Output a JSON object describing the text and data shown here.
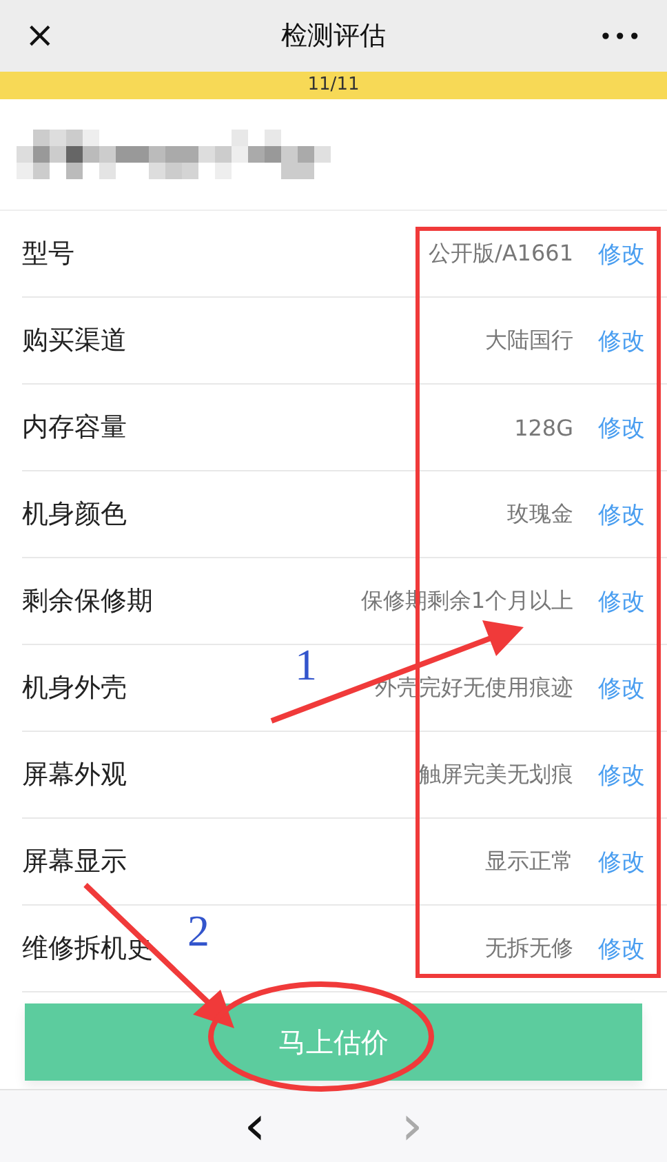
{
  "nav_bar": {
    "close": "×",
    "title": "检测评估",
    "more": "•••"
  },
  "progress": {
    "label": "11/11",
    "level": 1
  },
  "items": [
    {
      "label": "型号",
      "value": "公开版/A1661",
      "action": "修改"
    },
    {
      "label": "购买渠道",
      "value": "大陆国行",
      "action": "修改"
    },
    {
      "label": "内存容量",
      "value": "128G",
      "action": "修改"
    },
    {
      "label": "机身颜色",
      "value": "玫瑰金",
      "action": "修改"
    },
    {
      "label": "剩余保修期",
      "value": "保修期剩余1个月以上",
      "action": "修改"
    },
    {
      "label": "机身外壳",
      "value": "外壳完好无使用痕迹",
      "action": "修改"
    },
    {
      "label": "屏幕外观",
      "value": "触屏完美无划痕",
      "action": "修改"
    },
    {
      "label": "屏幕显示",
      "value": "显示正常",
      "action": "修改"
    },
    {
      "label": "维修拆机史",
      "value": "无拆无修",
      "action": "修改"
    }
  ],
  "submit_button": "马上估价",
  "bottom_bar": {
    "back": "‹",
    "forward": "›",
    "forward_disabled": true
  },
  "annotations": [
    "1",
    "2"
  ]
}
